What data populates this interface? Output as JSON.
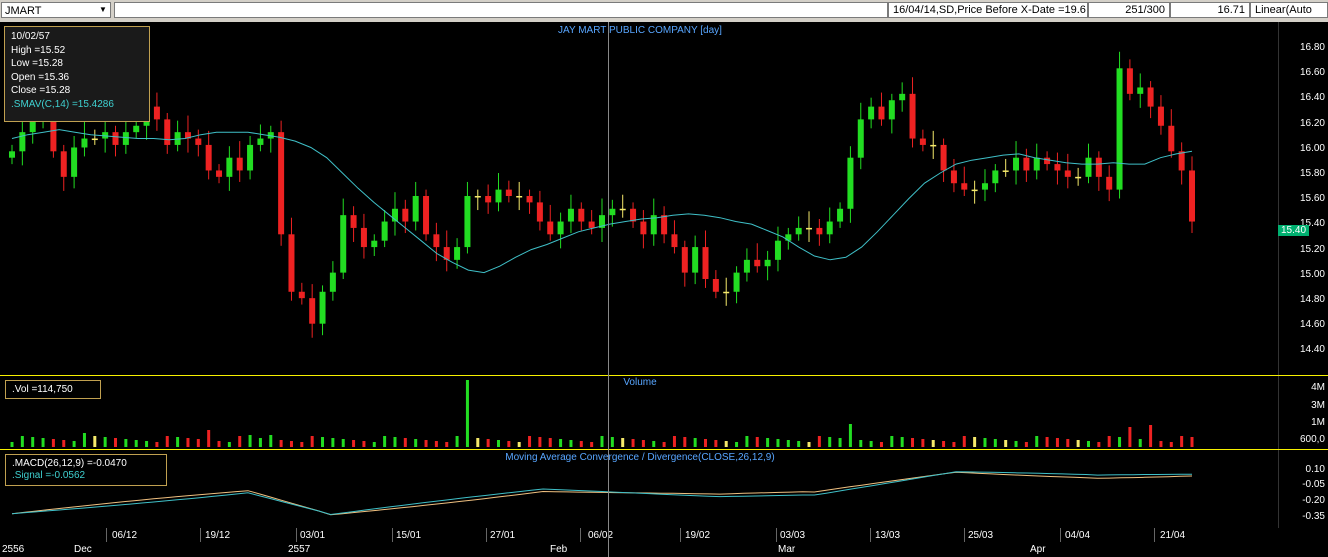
{
  "toolbar": {
    "symbol": "JMART",
    "info": "16/04/14,SD,Price Before X-Date =19.6",
    "count": "251/300",
    "last": "16.71",
    "scale": "Linear(Auto"
  },
  "price_panel": {
    "title": "JAY MART PUBLIC COMPANY [day]",
    "info": {
      "date": "10/02/57",
      "high": "High   =15.52",
      "low": "Low    =15.28",
      "open": "Open   =15.36",
      "close": "Close  =15.28",
      "sma": ".SMAV(C,14)   =15.4286"
    },
    "current_price": "15.40",
    "ticks": [
      "16.80",
      "16.60",
      "16.40",
      "16.20",
      "16.00",
      "15.80",
      "15.60",
      "15.40",
      "15.20",
      "15.00",
      "14.80",
      "14.60",
      "14.40"
    ]
  },
  "volume_panel": {
    "title": "Volume",
    "info": ".Vol   =114,750",
    "ticks": [
      "4M",
      "3M",
      "1M",
      "600,0"
    ]
  },
  "macd_panel": {
    "title": "Moving Average Convergence / Divergence(CLOSE,26,12,9)",
    "macd": ".MACD(26,12,9)    =-0.0470",
    "signal": ".Signal    =-0.0562",
    "ticks": [
      "0.10",
      "-0.05",
      "-0.20",
      "-0.35"
    ]
  },
  "dates": {
    "top": [
      "06/12",
      "19/12",
      "03/01",
      "15/01",
      "27/01",
      "06/02",
      "19/02",
      "03/03",
      "13/03",
      "25/03",
      "04/04",
      "21/04"
    ],
    "bottom": [
      "2556",
      "Dec",
      "2557",
      "Feb",
      "Mar",
      "Apr"
    ]
  },
  "chart_data": {
    "type": "candlestick",
    "title": "JAY MART PUBLIC COMPANY [day]",
    "ylim": [
      14.3,
      16.9
    ],
    "close": [
      15.95,
      16.1,
      16.2,
      16.3,
      15.95,
      15.75,
      15.98,
      16.05,
      16.05,
      16.1,
      16.0,
      16.1,
      16.15,
      16.3,
      16.2,
      16.0,
      16.1,
      16.05,
      16.0,
      15.8,
      15.75,
      15.9,
      15.8,
      16.0,
      16.05,
      16.1,
      15.3,
      14.85,
      14.8,
      14.6,
      14.85,
      15.0,
      15.45,
      15.35,
      15.2,
      15.25,
      15.4,
      15.5,
      15.4,
      15.6,
      15.3,
      15.2,
      15.1,
      15.2,
      15.6,
      15.6,
      15.55,
      15.65,
      15.6,
      15.6,
      15.55,
      15.4,
      15.3,
      15.4,
      15.5,
      15.4,
      15.35,
      15.45,
      15.5,
      15.5,
      15.4,
      15.3,
      15.45,
      15.3,
      15.2,
      15.0,
      15.2,
      14.95,
      14.85,
      14.85,
      15.0,
      15.1,
      15.05,
      15.1,
      15.25,
      15.3,
      15.35,
      15.35,
      15.3,
      15.4,
      15.5,
      15.9,
      16.2,
      16.3,
      16.2,
      16.35,
      16.4,
      16.05,
      16.0,
      16.0,
      15.8,
      15.7,
      15.65,
      15.65,
      15.7,
      15.8,
      15.8,
      15.9,
      15.8,
      15.9,
      15.85,
      15.8,
      15.75,
      15.75,
      15.9,
      15.75,
      15.65,
      16.6,
      16.4,
      16.45,
      16.3,
      16.15,
      15.95,
      15.8,
      15.4
    ],
    "sma": [
      16.05,
      16.08,
      16.1,
      16.12,
      16.1,
      16.08,
      16.07,
      16.06,
      16.05,
      16.05,
      16.04,
      16.05,
      16.08,
      16.1,
      16.1,
      16.1,
      16.08,
      16.06,
      16.03,
      15.98,
      15.9,
      15.78,
      15.66,
      15.55,
      15.45,
      15.35,
      15.25,
      15.15,
      15.08,
      15.02,
      15.0,
      15.05,
      15.12,
      15.18,
      15.22,
      15.27,
      15.32,
      15.35,
      15.38,
      15.4,
      15.42,
      15.43,
      15.45,
      15.46,
      15.45,
      15.43,
      15.4,
      15.38,
      15.33,
      15.28,
      15.2,
      15.13,
      15.1,
      15.12,
      15.2,
      15.32,
      15.45,
      15.58,
      15.7,
      15.78,
      15.85,
      15.88,
      15.9,
      15.92,
      15.93,
      15.9,
      15.88,
      15.86,
      15.85,
      15.85,
      15.86,
      15.85,
      15.85,
      15.9,
      15.93,
      15.95
    ]
  }
}
